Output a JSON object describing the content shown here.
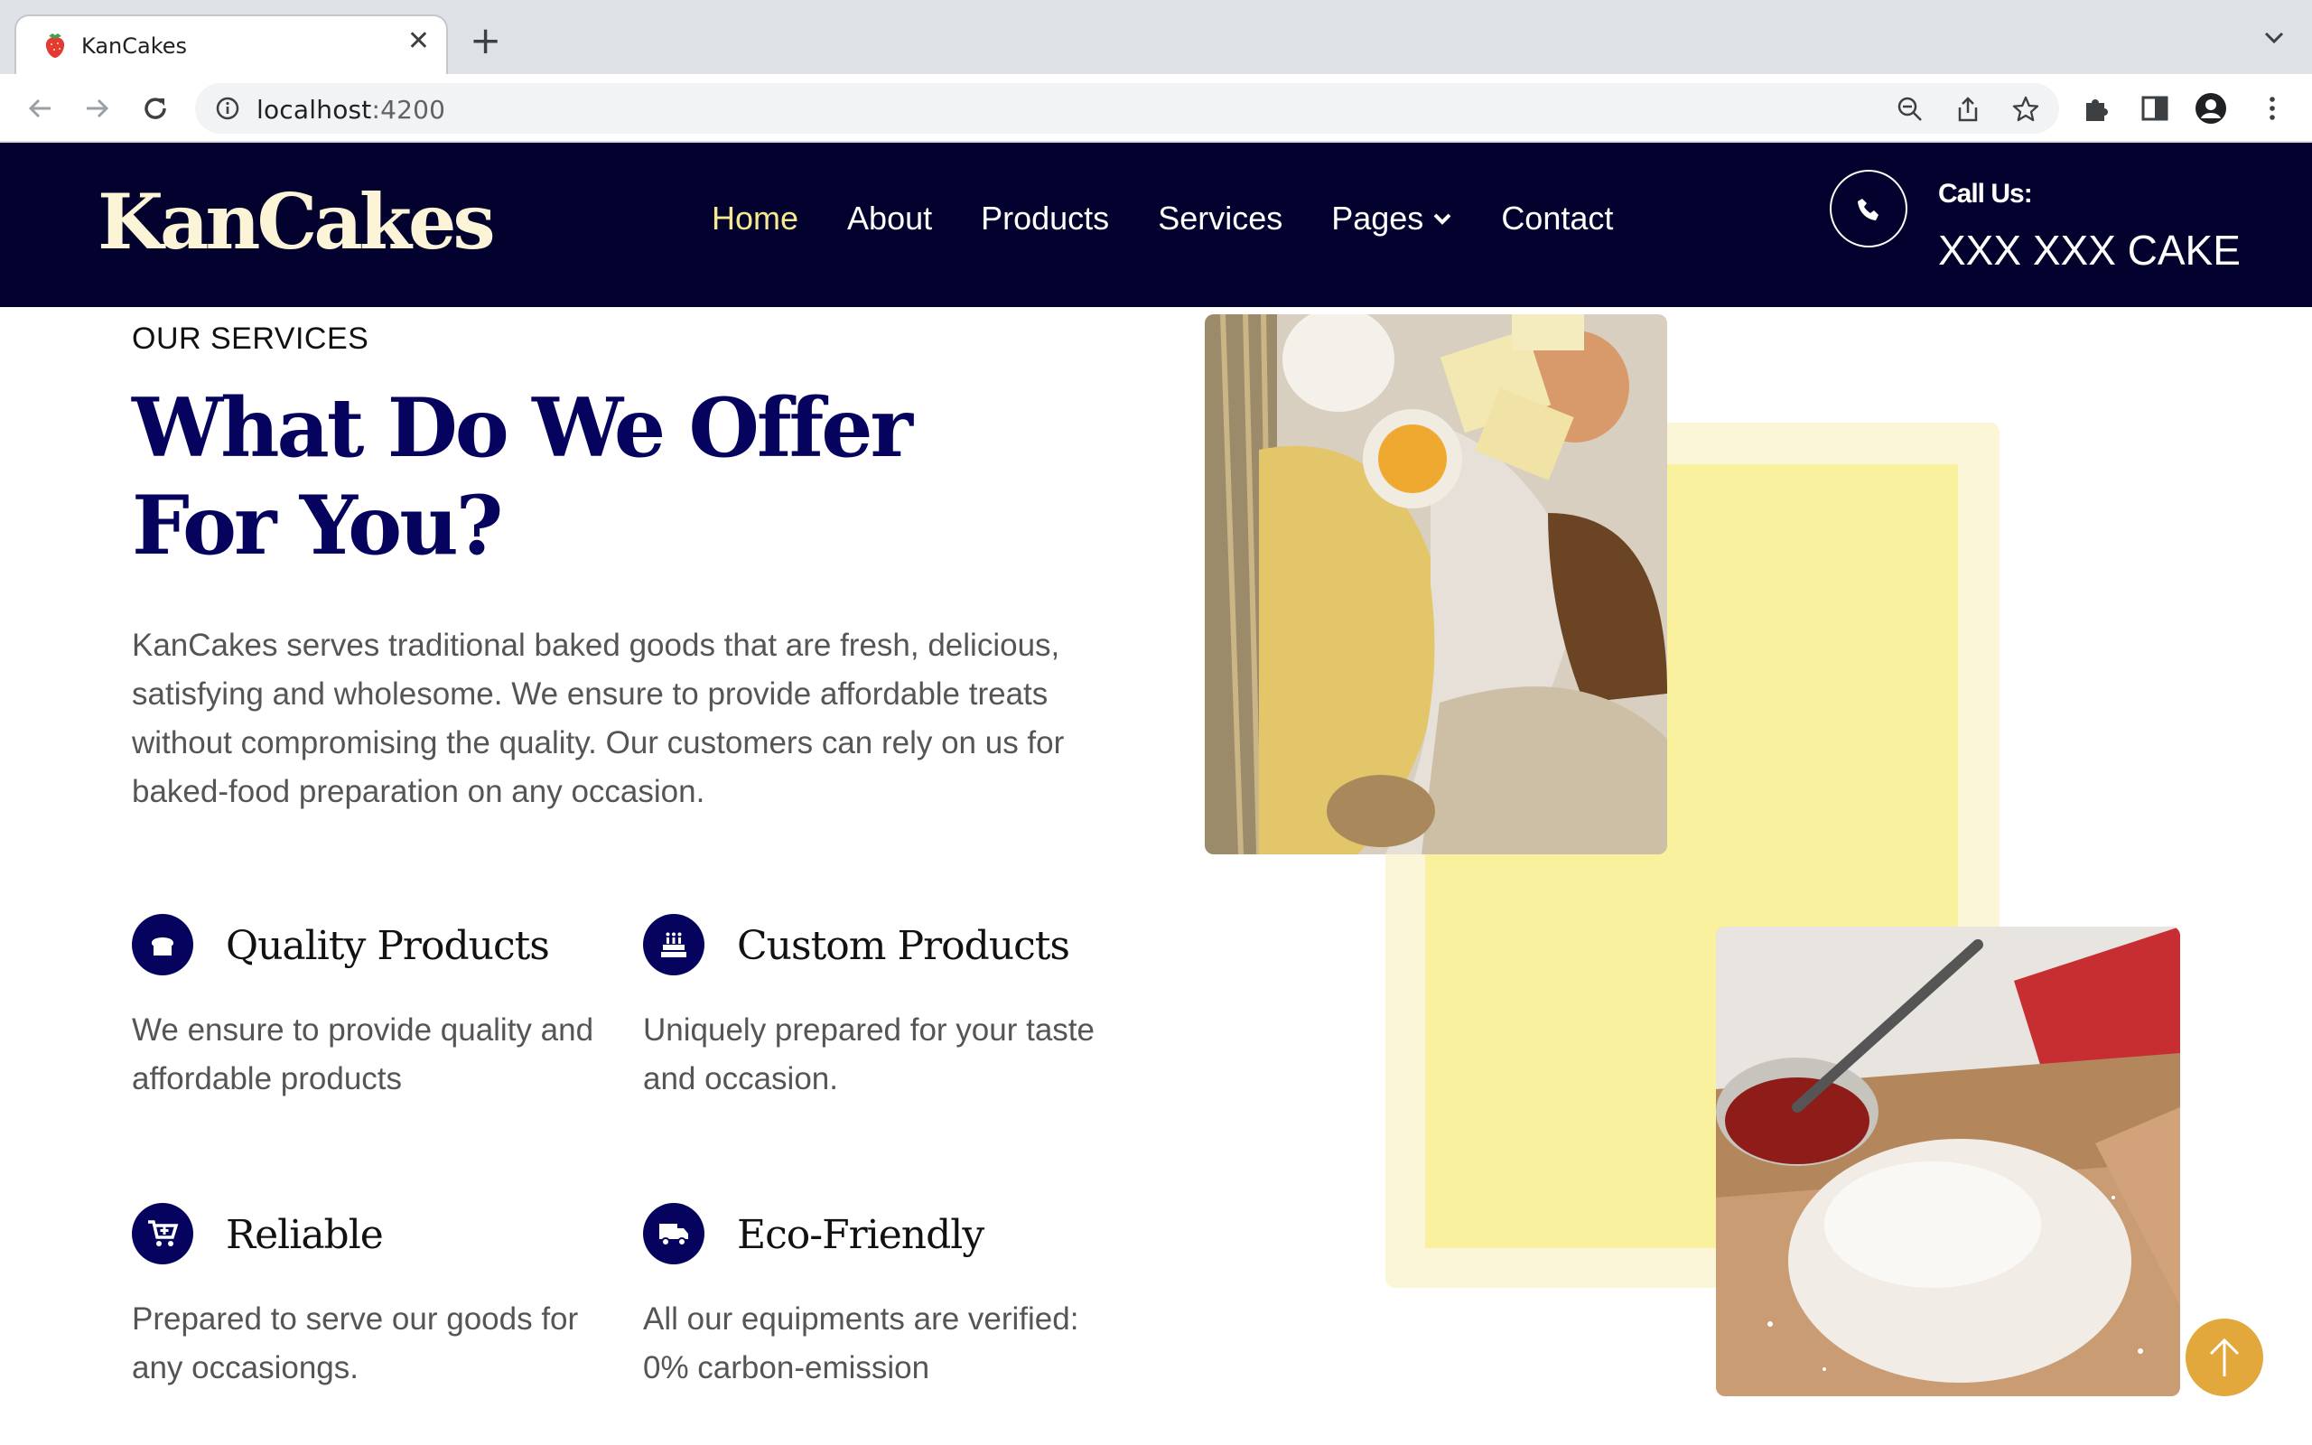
{
  "browser": {
    "tab_title": "KanCakes",
    "tab_favicon": "strawberry-icon",
    "url_host": "localhost",
    "url_port": ":4200"
  },
  "header": {
    "logo": "KanCakes",
    "nav": [
      {
        "label": "Home",
        "active": true
      },
      {
        "label": "About",
        "active": false
      },
      {
        "label": "Products",
        "active": false
      },
      {
        "label": "Services",
        "active": false
      },
      {
        "label": "Pages",
        "active": false,
        "has_dropdown": true
      },
      {
        "label": "Contact",
        "active": false
      }
    ],
    "call_label": "Call Us:",
    "call_number": "XXX XXX CAKE"
  },
  "services": {
    "eyebrow": "OUR SERVICES",
    "headline": "What Do We Offer For You?",
    "intro": "KanCakes serves traditional baked goods that are fresh, delicious, satisfying and wholesome. We ensure to provide affordable treats without compromising the quality. Our customers can rely on us for baked-food preparation on any occasion.",
    "features": [
      {
        "icon": "bread-icon",
        "title": "Quality Products",
        "desc": "We ensure to provide quality and affordable products"
      },
      {
        "icon": "birthday-cake-icon",
        "title": "Custom Products",
        "desc": "Uniquely prepared for your taste and occasion."
      },
      {
        "icon": "cart-plus-icon",
        "title": "Reliable",
        "desc": "Prepared to serve our goods for any occasiongs."
      },
      {
        "icon": "truck-icon",
        "title": "Eco-Friendly",
        "desc": "All our equipments are verified: 0% carbon-emission"
      }
    ]
  },
  "colors": {
    "header_bg": "#03022e",
    "brand_navy": "#05035e",
    "nav_active": "#f6ea8e",
    "logo_cream": "#fbf4d7",
    "yellow_accent": "#faf19f",
    "scroll_button": "#e2a83b"
  }
}
